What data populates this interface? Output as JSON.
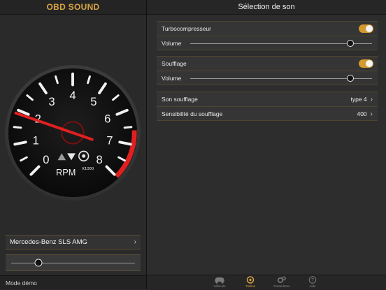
{
  "left": {
    "title": "OBD SOUND",
    "gauge": {
      "labels": [
        "0",
        "1",
        "2",
        "3",
        "4",
        "5",
        "6",
        "7",
        "8"
      ],
      "unit": "RPM",
      "multiplier": "X1000",
      "rpm_value": 1.9,
      "needle_color": "#e02020"
    },
    "car_selector": {
      "label": "Mercedes-Benz SLS AMG"
    },
    "slider": {
      "value": 0.22
    },
    "mode_label": "Mode démo"
  },
  "right": {
    "title": "Sélection de son",
    "group1": {
      "toggle_label": "Turbocompresseur",
      "toggle_on": true,
      "volume_label": "Volume",
      "volume_value": 0.88
    },
    "group2": {
      "toggle_label": "Soufflage",
      "toggle_on": true,
      "volume_label": "Volume",
      "volume_value": 0.88
    },
    "group3": {
      "rows": [
        {
          "label": "Son soufflage",
          "value": "type 4"
        },
        {
          "label": "Sensibilité du soufflage",
          "value": "400"
        }
      ]
    }
  },
  "tabbar": {
    "tabs": [
      {
        "label": "Véhicule",
        "icon": "car-icon",
        "active": false
      },
      {
        "label": "Turbos",
        "icon": "turbo-icon",
        "active": true
      },
      {
        "label": "Paramètres",
        "icon": "gears-icon",
        "active": false
      },
      {
        "label": "Aide",
        "icon": "help-icon",
        "active": false
      }
    ]
  },
  "colors": {
    "accent": "#d49a2f",
    "redline": "#e02020"
  }
}
